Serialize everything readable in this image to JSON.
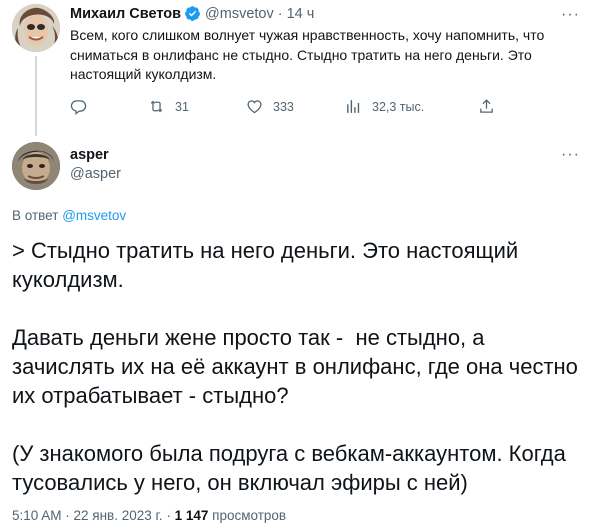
{
  "parent_tweet": {
    "display_name": "Михаил Светов",
    "handle": "@msvetov",
    "separator": "·",
    "time": "14 ч",
    "text": "Всем, кого слишком волнует чужая нравственность, хочу напомнить, что сниматься в онлифанс не стыдно. Стыдно тратить на него деньги. Это настоящий куколдизм.",
    "actions": {
      "reply_count": "",
      "retweet_count": "31",
      "like_count": "333",
      "views_count": "32,3 тыс."
    },
    "icons": [
      "verified-badge-icon",
      "more-icon",
      "reply-icon",
      "retweet-icon",
      "like-icon",
      "views-icon",
      "share-icon"
    ]
  },
  "main_tweet": {
    "display_name": "asper",
    "handle": "@asper",
    "reply_prefix": "В ответ",
    "reply_to_handle": "@msvetov",
    "text": "> Стыдно тратить на него деньги. Это настоящий куколдизм.\n\nДавать деньги жене просто так -  не стыдно, а зачислять их на её аккаунт в онлифанс, где она честно их отрабатывает - стыдно?\n\n(У знакомого была подруга с вебкам-аккаунтом. Когда тусовались у него, он включал эфиры с ней)",
    "timestamp": "5:10 AM · 22 янв. 2023 г.",
    "separator": "·",
    "views_count": "1 147",
    "views_label": "просмотров"
  },
  "colors": {
    "text_primary": "#0f1419",
    "text_secondary": "#536471",
    "accent_blue": "#1d9bf0",
    "divider": "#cfd9de"
  }
}
